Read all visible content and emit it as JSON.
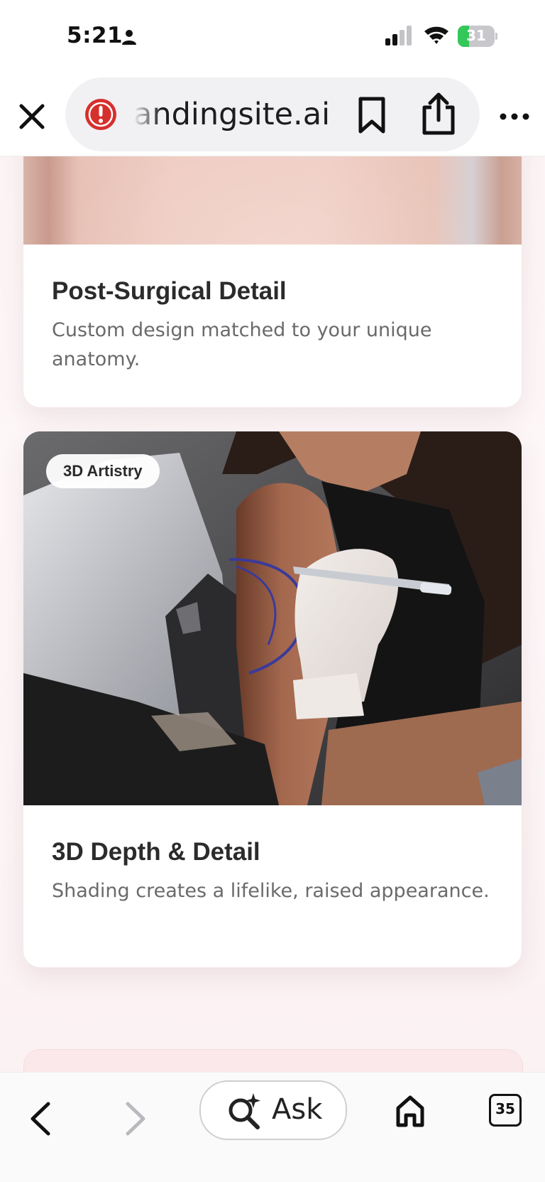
{
  "status_bar": {
    "time": "5:21",
    "battery_level": "31",
    "battery_percent": 31,
    "battery_color": "#34c759"
  },
  "browser": {
    "url": "andingsite.ai",
    "icons": {
      "close": "close-icon",
      "site_warning": "warning-icon",
      "bookmark": "bookmark-icon",
      "share": "share-icon",
      "more": "more-icon"
    }
  },
  "cards": [
    {
      "title": "Post-Surgical Detail",
      "description": "Custom design matched to your unique anatomy."
    },
    {
      "badge": "3D Artistry",
      "title": "3D Depth & Detail",
      "description": "Shading creates a lifelike, raised appearance."
    }
  ],
  "toolbar": {
    "ask_label": "Ask",
    "tab_count": "35",
    "icons": {
      "back": "chevron-left-icon",
      "forward": "chevron-right-icon",
      "ask": "ai-search-icon",
      "home": "home-icon",
      "tabs": "tabs-icon"
    }
  },
  "colors": {
    "warning_red": "#d6302c",
    "page_background": "#fbf3f4"
  }
}
